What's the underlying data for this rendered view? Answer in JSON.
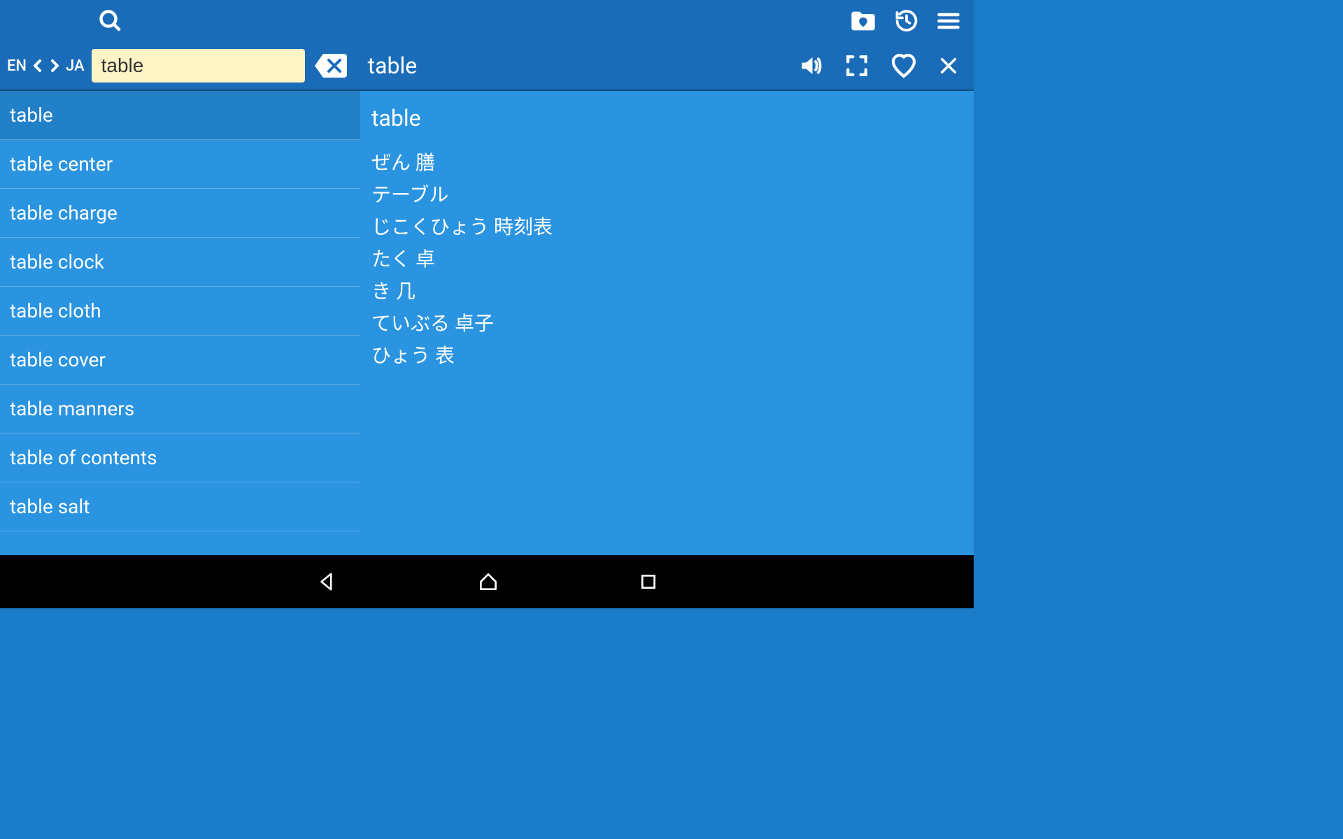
{
  "languages": {
    "from": "EN",
    "to": "JA"
  },
  "search": {
    "value": "table"
  },
  "detailTitle": "table",
  "suggestions": [
    "table",
    "table center",
    "table charge",
    "table clock",
    "table cloth",
    "table cover",
    "table manners",
    "table of contents",
    "table salt"
  ],
  "detail": {
    "headword": "table",
    "translations": [
      "ぜん 膳",
      "テーブル",
      "じこくひょう 時刻表",
      "たく 卓",
      "き 几",
      "ていぶる 卓子",
      "ひょう 表"
    ]
  }
}
